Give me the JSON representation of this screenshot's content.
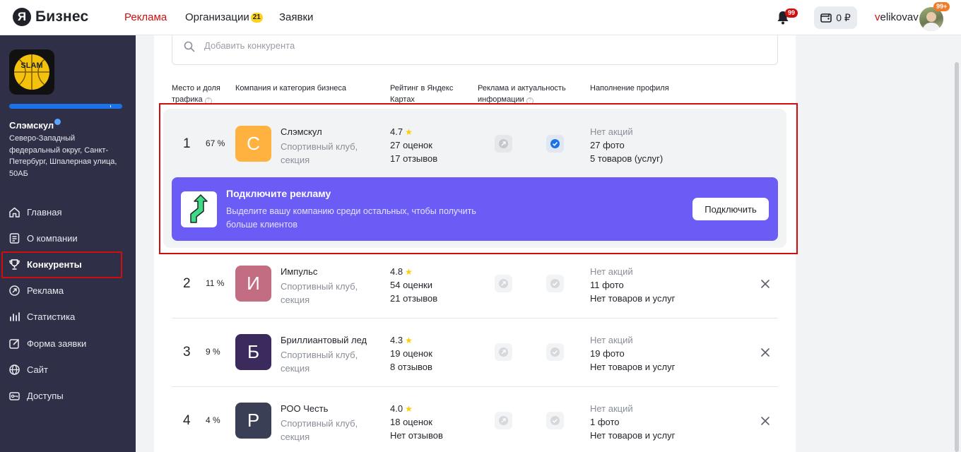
{
  "header": {
    "logo_letter": "Я",
    "logo_text": "Бизнес",
    "nav": [
      {
        "label": "Реклама",
        "active": true
      },
      {
        "label": "Организации",
        "badge": "21"
      },
      {
        "label": "Заявки"
      }
    ],
    "notifications_badge": "99",
    "balance": "0 ₽",
    "username_first": "v",
    "username_rest": "elikovav",
    "avatar_badge": "99+"
  },
  "sidebar": {
    "company_name": "Слэмскул",
    "company_address": "Северо-Западный федеральный округ, Санкт-Петербург, Шпалерная улица, 50АБ",
    "logo_text": "SLAM",
    "menu": [
      {
        "label": "Главная",
        "icon": "home-icon"
      },
      {
        "label": "О компании",
        "icon": "document-icon"
      },
      {
        "label": "Конкуренты",
        "icon": "trophy-icon",
        "active": true
      },
      {
        "label": "Реклама",
        "icon": "ads-icon"
      },
      {
        "label": "Статистика",
        "icon": "stats-icon"
      },
      {
        "label": "Форма заявки",
        "icon": "edit-icon"
      },
      {
        "label": "Сайт",
        "icon": "globe-icon"
      },
      {
        "label": "Доступы",
        "icon": "key-icon"
      }
    ]
  },
  "search": {
    "placeholder": "Добавить конкурента"
  },
  "columns": {
    "place": "Место и доля трафика",
    "company": "Компания и категория бизнеса",
    "rating": "Рейтинг в Яндекс Картах",
    "ads": "Реклама и актуальность информации",
    "profile": "Наполнение профиля"
  },
  "rows": [
    {
      "rank": "1",
      "share": "67 %",
      "letter": "С",
      "color": "#ffb23f",
      "name": "Слэмскул",
      "category": "Спортивный клуб, секция",
      "rating": "4.7",
      "ratings_count": "27 оценок",
      "reviews": "17 отзывов",
      "ads_active": false,
      "info_active": true,
      "promos": "Нет акций",
      "photos": "27 фото",
      "goods": "5 товаров (услуг)",
      "removable": false
    },
    {
      "rank": "2",
      "share": "11 %",
      "letter": "И",
      "color": "#c36d83",
      "name": "Импульс",
      "category": "Спортивный клуб, секция",
      "rating": "4.8",
      "ratings_count": "54 оценки",
      "reviews": "21 отзывов",
      "ads_active": false,
      "info_active": false,
      "promos": "Нет акций",
      "photos": "11 фото",
      "goods": "Нет товаров и услуг",
      "removable": true
    },
    {
      "rank": "3",
      "share": "9 %",
      "letter": "Б",
      "color": "#3b2a5c",
      "name": "Бриллиантовый лед",
      "category": "Спортивный клуб, секция",
      "rating": "4.3",
      "ratings_count": "19 оценок",
      "reviews": "8 отзывов",
      "ads_active": false,
      "info_active": false,
      "promos": "Нет акций",
      "photos": "19 фото",
      "goods": "Нет товаров и услуг",
      "removable": true
    },
    {
      "rank": "4",
      "share": "4 %",
      "letter": "Р",
      "color": "#3a3f55",
      "name": "РОО Честь",
      "category": "Спортивный клуб, секция",
      "rating": "4.0",
      "ratings_count": "18 оценок",
      "reviews": "Нет отзывов",
      "ads_active": false,
      "info_active": false,
      "promos": "Нет акций",
      "photos": "1 фото",
      "goods": "Нет товаров и услуг",
      "removable": true
    }
  ],
  "promo": {
    "title": "Подключите рекламу",
    "text": "Выделите вашу компанию среди остальных, чтобы получить больше клиентов",
    "button": "Подключить"
  },
  "colors": {
    "accent_red": "#d10e0e",
    "promo_purple": "#6b5cf6",
    "sidebar_bg": "#2f3047",
    "check_blue": "#1a73e8"
  }
}
